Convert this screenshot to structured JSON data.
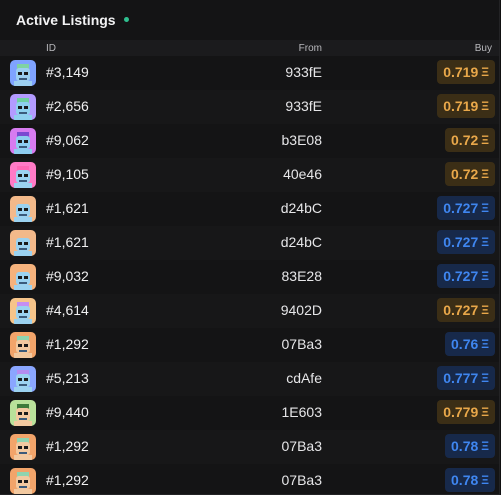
{
  "header": {
    "title": "Active Listings"
  },
  "columns": {
    "id": "ID",
    "from": "From",
    "buy": "Buy"
  },
  "colors": {
    "gold": "#e9a84a",
    "blue": "#3f86f0",
    "live": "#2fbf8f"
  },
  "eth_symbol": "Ξ",
  "listings": [
    {
      "id": "#3,149",
      "from": "933fE",
      "price": "0.719",
      "tone": "gold",
      "avatar": {
        "bg": "#7fa3ff",
        "skin": "#9ccff0",
        "hat": "#7fd3a3"
      }
    },
    {
      "id": "#2,656",
      "from": "933fE",
      "price": "0.719",
      "tone": "gold",
      "avatar": {
        "bg": "#b39bff",
        "skin": "#8ed0ee",
        "hat": "#6fd0a0"
      }
    },
    {
      "id": "#9,062",
      "from": "b3E08",
      "price": "0.72",
      "tone": "gold",
      "avatar": {
        "bg": "#d77bf0",
        "skin": "#8ecdf0",
        "hat": "#7a4ad1"
      }
    },
    {
      "id": "#9,105",
      "from": "40e46",
      "price": "0.72",
      "tone": "gold",
      "avatar": {
        "bg": "#ff7ac6",
        "skin": "#9bd2f0",
        "hat": "#ff67b5"
      }
    },
    {
      "id": "#1,621",
      "from": "d24bC",
      "price": "0.727",
      "tone": "blue",
      "avatar": {
        "bg": "#f3b98a",
        "skin": "#9bd2f0",
        "hat": "#f3b98a"
      }
    },
    {
      "id": "#1,621",
      "from": "d24bC",
      "price": "0.727",
      "tone": "blue",
      "avatar": {
        "bg": "#f3b98a",
        "skin": "#9bd2f0",
        "hat": "#f3b98a"
      }
    },
    {
      "id": "#9,032",
      "from": "83E28",
      "price": "0.727",
      "tone": "blue",
      "avatar": {
        "bg": "#f5b27c",
        "skin": "#9bd2f0",
        "hat": "#f5b27c"
      }
    },
    {
      "id": "#4,614",
      "from": "9402D",
      "price": "0.727",
      "tone": "gold",
      "avatar": {
        "bg": "#f6c48a",
        "skin": "#9bd2f0",
        "hat": "#c58ef2"
      }
    },
    {
      "id": "#1,292",
      "from": "07Ba3",
      "price": "0.76",
      "tone": "blue",
      "avatar": {
        "bg": "#f2a46a",
        "skin": "#f2c9a0",
        "hat": "#8fd4b0"
      }
    },
    {
      "id": "#5,213",
      "from": "cdAfe",
      "price": "0.777",
      "tone": "blue",
      "avatar": {
        "bg": "#8aa6ff",
        "skin": "#9bd2f0",
        "hat": "#b48cf0"
      }
    },
    {
      "id": "#9,440",
      "from": "1E603",
      "price": "0.779",
      "tone": "gold",
      "avatar": {
        "bg": "#b9e19a",
        "skin": "#f2c9a0",
        "hat": "#3e7a3a"
      }
    },
    {
      "id": "#1,292",
      "from": "07Ba3",
      "price": "0.78",
      "tone": "blue",
      "avatar": {
        "bg": "#f2a46a",
        "skin": "#f2c9a0",
        "hat": "#8fd4b0"
      }
    },
    {
      "id": "#1,292",
      "from": "07Ba3",
      "price": "0.78",
      "tone": "blue",
      "avatar": {
        "bg": "#f2a46a",
        "skin": "#f2c9a0",
        "hat": "#8fd4b0"
      }
    }
  ]
}
